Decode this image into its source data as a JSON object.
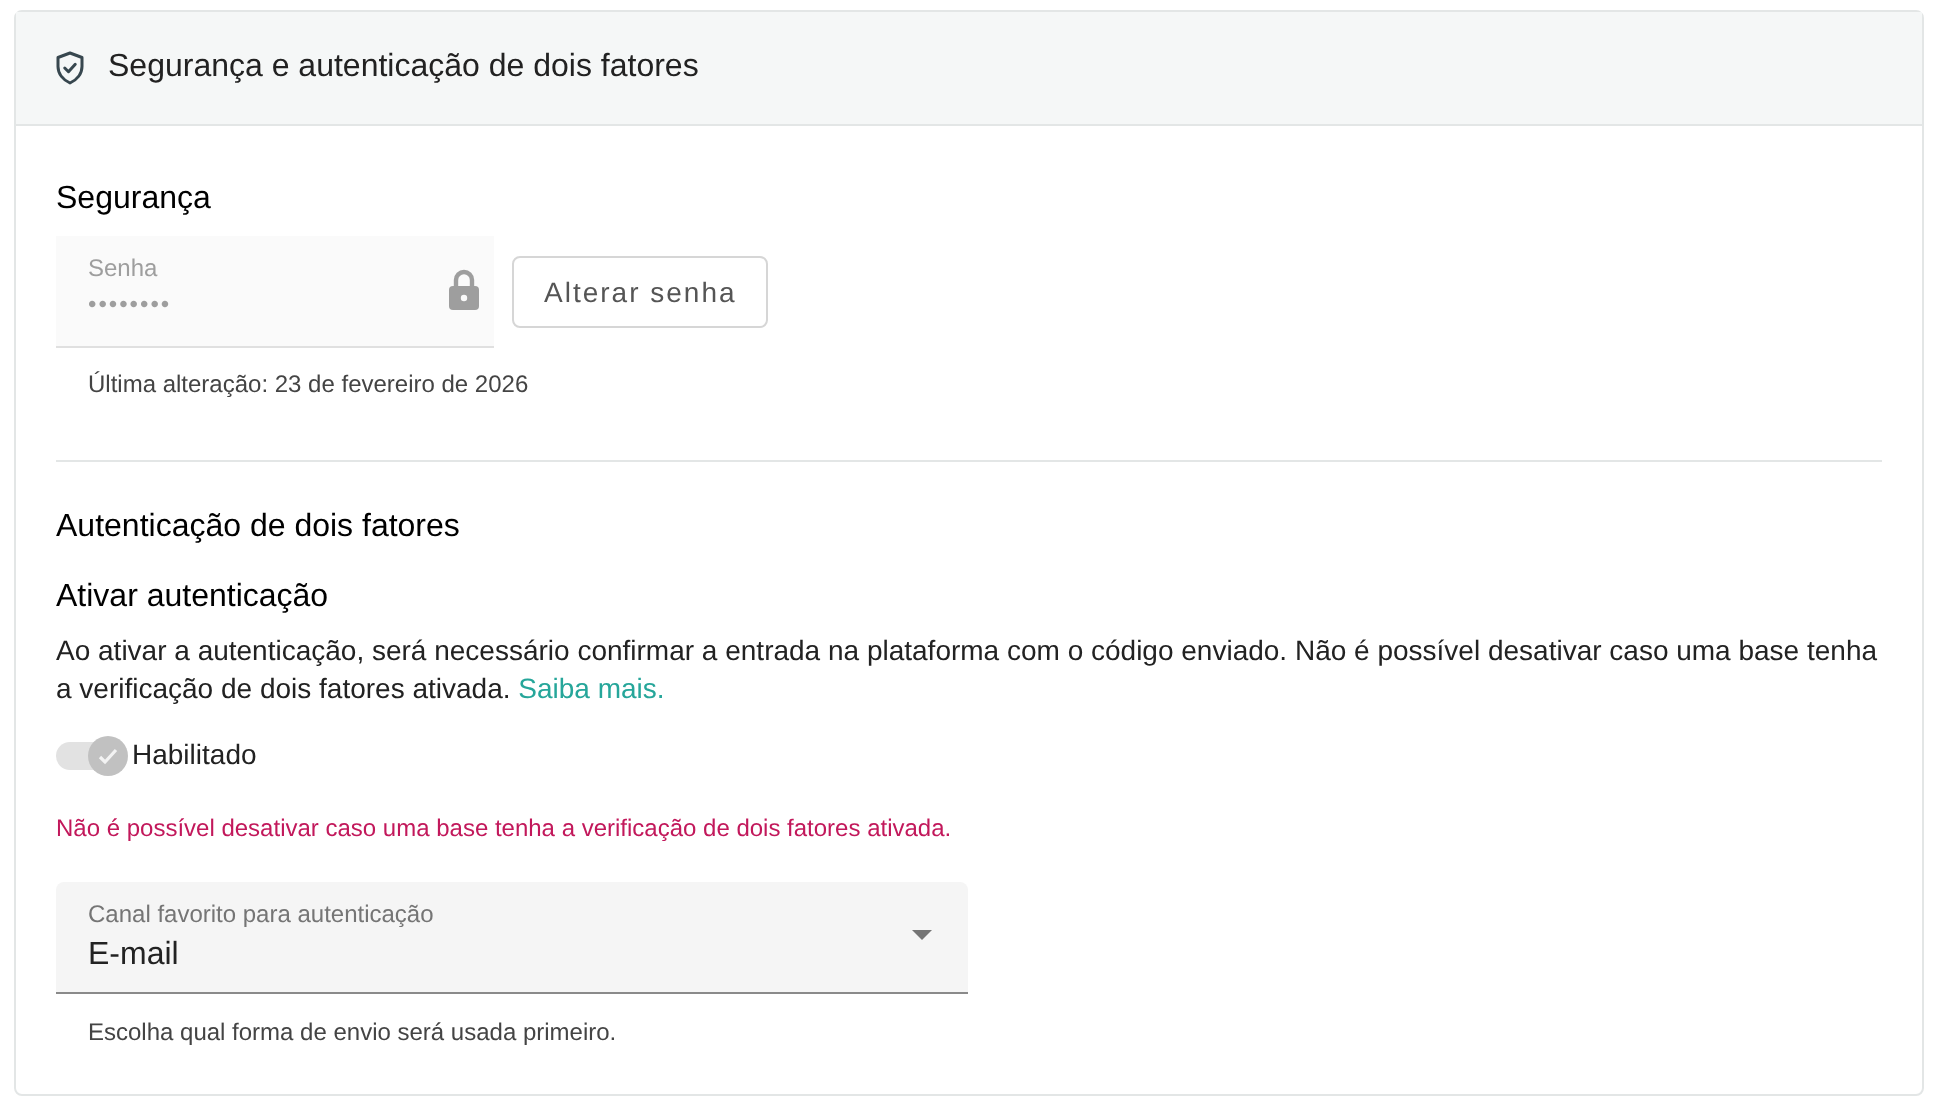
{
  "header": {
    "title": "Segurança e autenticação de dois fatores"
  },
  "security": {
    "heading": "Segurança",
    "password_field": {
      "label": "Senha",
      "value": "••••••••",
      "locked": true
    },
    "change_button": "Alterar senha",
    "last_changed": "Última alteração: 23 de fevereiro de 2026"
  },
  "two_factor": {
    "heading": "Autenticação de dois fatores",
    "subheading": "Ativar autenticação",
    "description": "Ao ativar a autenticação, será necessário confirmar a entrada na plataforma com o código enviado. Não é possível desativar caso uma base tenha a verificação de dois fatores ativada.",
    "link": "Saiba mais.",
    "toggle": {
      "label": "Habilitado",
      "on": true,
      "disabled": true
    },
    "warning": "Não é possível desativar caso uma base tenha a verificação de dois fatores ativada.",
    "channel_select": {
      "label": "Canal favorito para autenticação",
      "value": "E-mail",
      "helper": "Escolha qual forma de envio será usada primeiro."
    }
  }
}
